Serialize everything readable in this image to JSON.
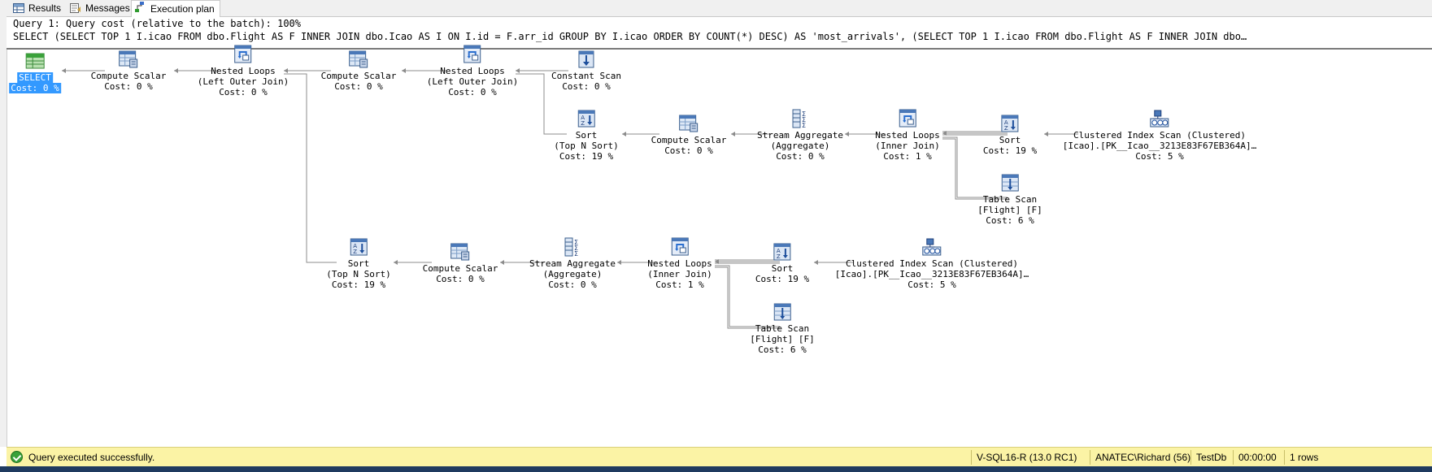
{
  "tabs": [
    {
      "label": "Results",
      "icon": "grid-icon"
    },
    {
      "label": "Messages",
      "icon": "messages-icon"
    },
    {
      "label": "Execution plan",
      "icon": "execution-plan-icon",
      "active": true
    }
  ],
  "header": {
    "line1": "Query 1: Query cost (relative to the batch): 100%",
    "line2": "SELECT (SELECT TOP 1 I.icao FROM dbo.Flight AS F INNER JOIN dbo.Icao AS I ON I.id = F.arr_id GROUP BY I.icao ORDER BY COUNT(*) DESC) AS 'most_arrivals', (SELECT TOP 1 I.icao FROM dbo.Flight AS F INNER JOIN dbo…"
  },
  "operators": [
    {
      "id": "select",
      "icon": "select-icon",
      "lines": [
        "SELECT",
        "Cost: 0 %"
      ],
      "selected": true
    },
    {
      "id": "compute1",
      "icon": "compute-scalar-icon",
      "lines": [
        "Compute Scalar",
        "Cost: 0 %"
      ]
    },
    {
      "id": "nl1",
      "icon": "nested-loops-icon",
      "lines": [
        "Nested Loops",
        "(Left Outer Join)",
        "Cost: 0 %"
      ]
    },
    {
      "id": "compute2",
      "icon": "compute-scalar-icon",
      "lines": [
        "Compute Scalar",
        "Cost: 0 %"
      ]
    },
    {
      "id": "nl2",
      "icon": "nested-loops-icon",
      "lines": [
        "Nested Loops",
        "(Left Outer Join)",
        "Cost: 0 %"
      ]
    },
    {
      "id": "constscan",
      "icon": "constant-scan-icon",
      "lines": [
        "Constant Scan",
        "Cost: 0 %"
      ]
    },
    {
      "id": "sort_a",
      "icon": "sort-icon",
      "lines": [
        "Sort",
        "(Top N Sort)",
        "Cost: 19 %"
      ]
    },
    {
      "id": "compute3",
      "icon": "compute-scalar-icon",
      "lines": [
        "Compute Scalar",
        "Cost: 0 %"
      ]
    },
    {
      "id": "stream_a",
      "icon": "stream-aggregate-icon",
      "lines": [
        "Stream Aggregate",
        "(Aggregate)",
        "Cost: 0 %"
      ]
    },
    {
      "id": "nl3",
      "icon": "nested-loops-icon",
      "lines": [
        "Nested Loops",
        "(Inner Join)",
        "Cost: 1 %"
      ]
    },
    {
      "id": "sort_b",
      "icon": "sort-icon",
      "lines": [
        "Sort",
        "Cost: 19 %"
      ]
    },
    {
      "id": "cis_a",
      "icon": "clustered-index-scan-icon",
      "lines": [
        "Clustered Index Scan (Clustered)",
        "[Icao].[PK__Icao__3213E83F67EB364A]…",
        "Cost: 5 %"
      ]
    },
    {
      "id": "tscan_a",
      "icon": "table-scan-icon",
      "lines": [
        "Table Scan",
        "[Flight] [F]",
        "Cost: 6 %"
      ]
    },
    {
      "id": "sort_c",
      "icon": "sort-icon",
      "lines": [
        "Sort",
        "(Top N Sort)",
        "Cost: 19 %"
      ]
    },
    {
      "id": "compute4",
      "icon": "compute-scalar-icon",
      "lines": [
        "Compute Scalar",
        "Cost: 0 %"
      ]
    },
    {
      "id": "stream_b",
      "icon": "stream-aggregate-icon",
      "lines": [
        "Stream Aggregate",
        "(Aggregate)",
        "Cost: 0 %"
      ]
    },
    {
      "id": "nl4",
      "icon": "nested-loops-icon",
      "lines": [
        "Nested Loops",
        "(Inner Join)",
        "Cost: 1 %"
      ]
    },
    {
      "id": "sort_d",
      "icon": "sort-icon",
      "lines": [
        "Sort",
        "Cost: 19 %"
      ]
    },
    {
      "id": "cis_b",
      "icon": "clustered-index-scan-icon",
      "lines": [
        "Clustered Index Scan (Clustered)",
        "[Icao].[PK__Icao__3213E83F67EB364A]…",
        "Cost: 5 %"
      ]
    },
    {
      "id": "tscan_b",
      "icon": "table-scan-icon",
      "lines": [
        "Table Scan",
        "[Flight] [F]",
        "Cost: 6 %"
      ]
    }
  ],
  "status": {
    "message": "Query executed successfully.",
    "server": "V-SQL16-R (13.0 RC1)",
    "user": "ANATEC\\Richard (56)",
    "database": "TestDb",
    "elapsed": "00:00:00",
    "rows": "1 rows"
  },
  "colors": {
    "selection": "#3399ff",
    "status_bar": "#fbf3a5",
    "window_border": "#1f3a5f"
  }
}
